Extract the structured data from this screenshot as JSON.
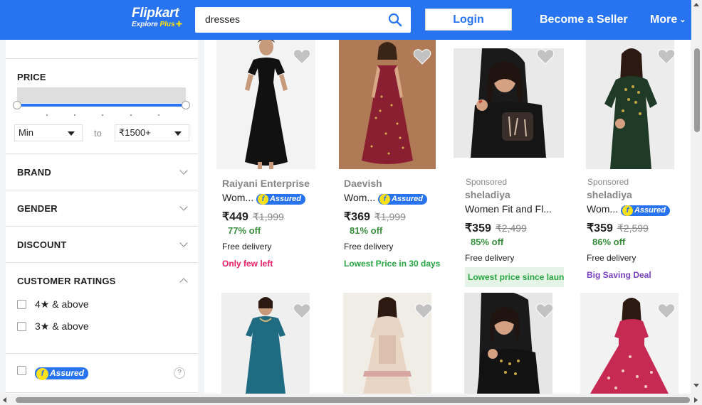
{
  "header": {
    "logo_main": "Flipkart",
    "logo_sub": "Explore",
    "logo_plus": "Plus",
    "search_value": "dresses",
    "login_label": "Login",
    "seller_label": "Become a Seller",
    "more_label": "More"
  },
  "filters": {
    "price_title": "PRICE",
    "min_value": "Min",
    "to_label": "to",
    "max_value": "₹1500+",
    "brand": "BRAND",
    "gender": "GENDER",
    "discount": "DISCOUNT",
    "ratings": "CUSTOMER RATINGS",
    "rating_options": [
      "4★ & above",
      "3★ & above"
    ],
    "assured": "Assured",
    "help": "?"
  },
  "assured_label": "Assured",
  "products": [
    {
      "sponsored": "",
      "brand": "Raiyani Enterprise",
      "title": "Wom...",
      "assured": true,
      "price": "₹449",
      "mrp": "₹1,999",
      "off": "77% off",
      "delivery": "Free delivery",
      "tag": "Only few left"
    },
    {
      "sponsored": "",
      "brand": "Daevish",
      "title": "Wom...",
      "assured": true,
      "price": "₹369",
      "mrp": "₹1,999",
      "off": "81% off",
      "delivery": "Free delivery",
      "tag": "Lowest Price in 30 days"
    },
    {
      "sponsored": "Sponsored",
      "brand": "sheladiya",
      "title": "Women Fit and Fl...",
      "assured": false,
      "price": "₹359",
      "mrp": "₹2,499",
      "off": "85% off",
      "delivery": "Free delivery",
      "tag": "Lowest price since launch"
    },
    {
      "sponsored": "Sponsored",
      "brand": "sheladiya",
      "title": "Wom...",
      "assured": true,
      "price": "₹359",
      "mrp": "₹2,599",
      "off": "86% off",
      "delivery": "Free delivery",
      "tag": "Big Saving Deal"
    }
  ],
  "colors": {
    "brand_blue": "#2874f0",
    "assured_yellow": "#ffe11b",
    "discount_green": "#388e3c",
    "tag_red": "#e91e63",
    "tag_green": "#26a541",
    "tag_purple": "#7b40c1"
  }
}
